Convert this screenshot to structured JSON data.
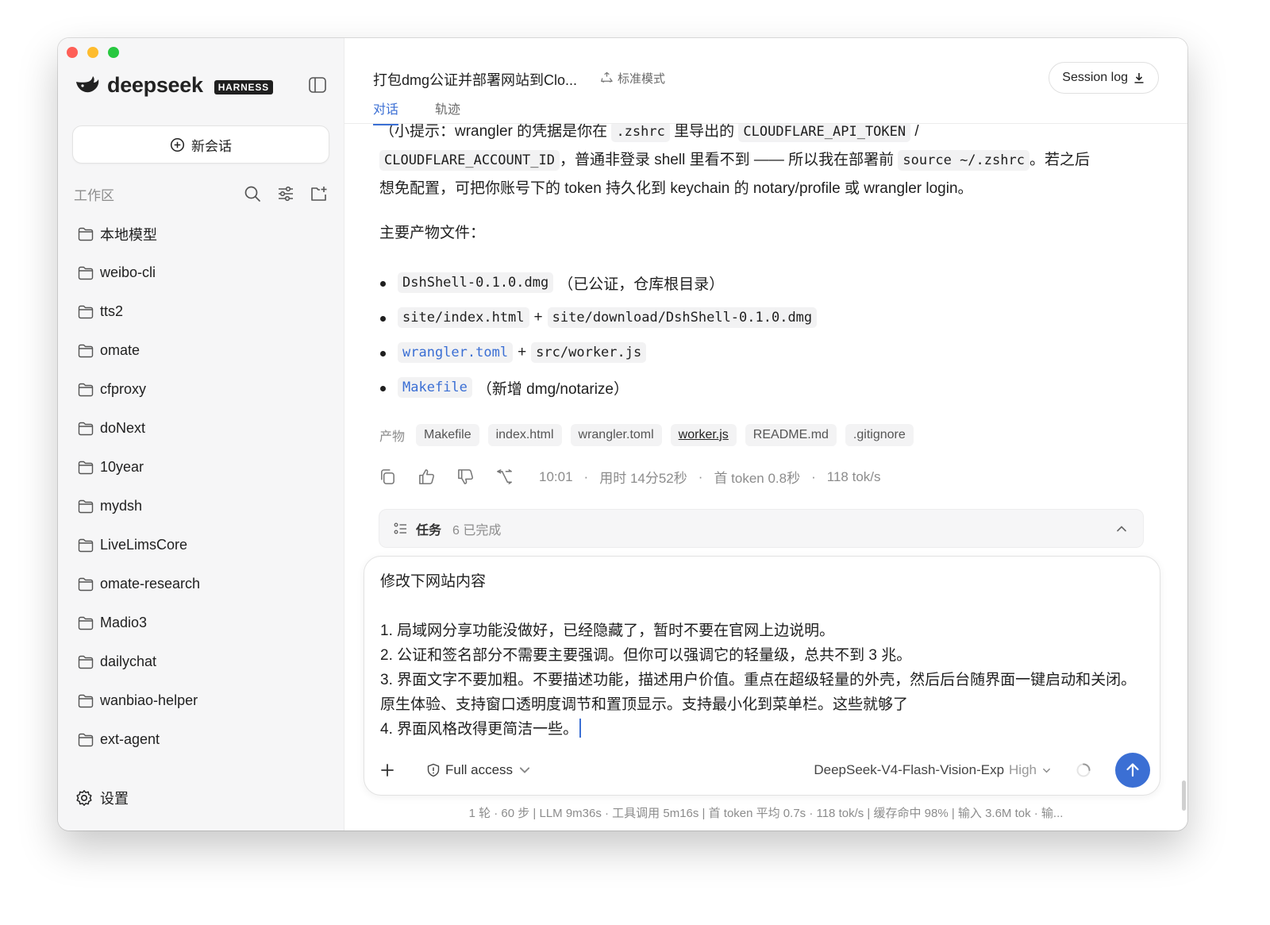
{
  "app": {
    "brand_name": "deepseek",
    "brand_badge": "HARNESS"
  },
  "sidebar": {
    "new_chat_label": "新会话",
    "workspace_title": "工作区",
    "folders": [
      "本地模型",
      "weibo-cli",
      "tts2",
      "omate",
      "cfproxy",
      "doNext",
      "10year",
      "mydsh",
      "LiveLimsCore",
      "omate-research",
      "Madio3",
      "dailychat",
      "wanbiao-helper",
      "ext-agent"
    ],
    "settings_label": "设置"
  },
  "header": {
    "title": "打包dmg公证并部署网站到Clo...",
    "mode": "标准模式",
    "session_log": "Session log",
    "tabs": [
      "对话",
      "轨迹"
    ],
    "active_tab": 0
  },
  "message": {
    "line1_partial": "（小提示：wrangler 的凭据是你在 ",
    "line1_code1": ".zshrc",
    "line1_mid": " 里导出的 ",
    "line1_code2": "CLOUDFLARE_API_TOKEN",
    "line1_end": " /",
    "line2_code": "CLOUDFLARE_ACCOUNT_ID",
    "line2_text": "，普通非登录 shell 里看不到 —— 所以我在部署前 ",
    "line2_code2": "source ~/.zshrc",
    "line2_text2": "。若之后",
    "line3_text": "想免配置，可把你账号下的 token 持久化到 keychain 的 notary/profile 或 wrangler login。",
    "heading": "主要产物文件：",
    "files": [
      {
        "code": "DshShell-0.1.0.dmg",
        "note": "（已公证，仓库根目录）"
      },
      {
        "code": "site/index.html",
        "plus": "+",
        "code2": "site/download/DshShell-0.1.0.dmg"
      },
      {
        "code": "wrangler.toml",
        "plus": "+",
        "code2": "src/worker.js"
      },
      {
        "code": "Makefile",
        "note": "（新增 dmg/notarize）"
      }
    ]
  },
  "artifacts": {
    "label": "产物",
    "items": [
      "Makefile",
      "index.html",
      "wrangler.toml",
      "worker.js",
      "README.md",
      ".gitignore"
    ]
  },
  "meta": {
    "time": "10:01",
    "duration": "用时 14分52秒",
    "first_token": "首 token 0.8秒",
    "speed": "118 tok/s",
    "sep": "·"
  },
  "tasks": {
    "label": "任务",
    "count": "6 已完成"
  },
  "composer": {
    "text": "修改下网站内容\n\n1. 局域网分享功能没做好，已经隐藏了，暂时不要在官网上边说明。\n2. 公证和签名部分不需要主要强调。但你可以强调它的轻量级，总共不到 3 兆。\n3. 界面文字不要加粗。不要描述功能，描述用户价值。重点在超级轻量的外壳，然后后台随界面一键启动和关闭。原生体验、支持窗口透明度调节和置顶显示。支持最小化到菜单栏。这些就够了\n4. 界面风格改得更简洁一些。",
    "access": "Full access",
    "model": "DeepSeek-V4-Flash-Vision-Exp",
    "effort": "High"
  },
  "footer": "1 轮 · 60 步  |  LLM 9m36s · 工具调用 5m16s  |  首 token 平均 0.7s · 118 tok/s  |  缓存命中 98%  |  输入 3.6M tok · 输...",
  "colors": {
    "accent": "#3b6fd4",
    "sidebar_bg": "#f6f6f7"
  }
}
